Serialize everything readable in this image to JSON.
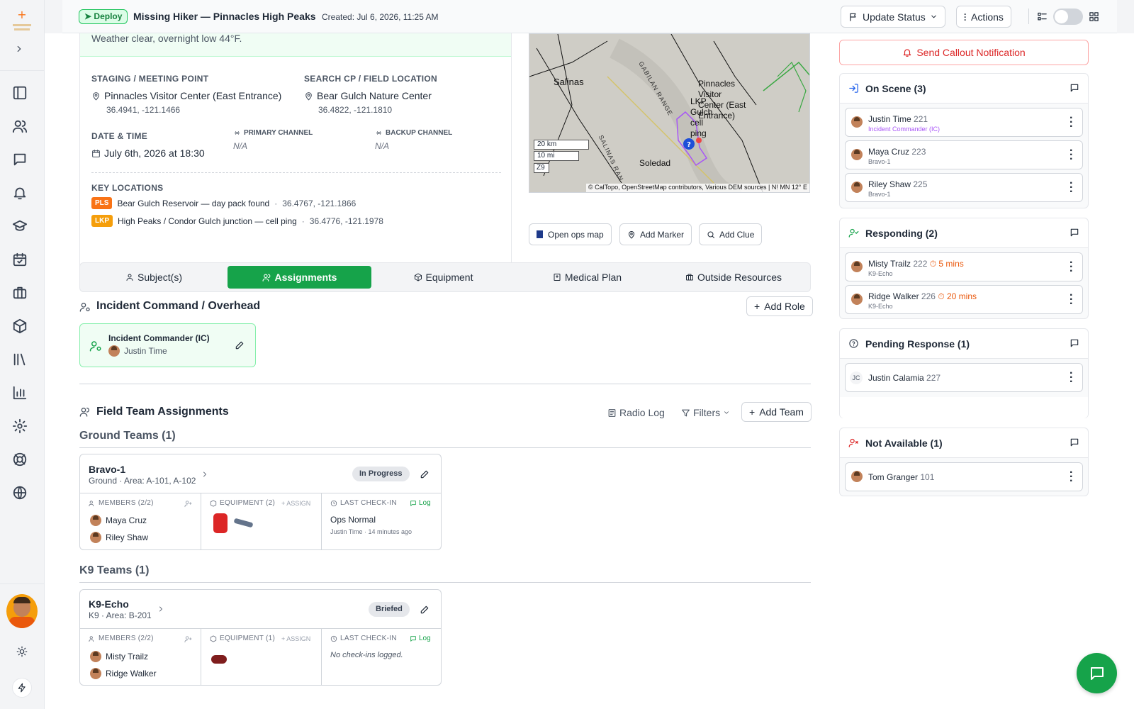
{
  "topbar": {
    "deploy": "Deploy",
    "title": "Missing Hiker — Pinnacles High Peaks",
    "created": "Created: Jul 6, 2026, 11:25 AM",
    "update_status": "Update Status",
    "actions": "Actions"
  },
  "briefing": {
    "weather": "Weather clear, overnight low 44°F.",
    "staging_label": "STAGING / MEETING POINT",
    "staging_name": "Pinnacles Visitor Center (East Entrance)",
    "staging_coords": "36.4941, -121.1466",
    "cp_label": "SEARCH CP / FIELD LOCATION",
    "cp_name": "Bear Gulch Nature Center",
    "cp_coords": "36.4822, -121.1810",
    "datetime_label": "DATE & TIME",
    "datetime": "July 6th, 2026 at 18:30",
    "primary_label": "PRIMARY CHANNEL",
    "primary": "N/A",
    "backup_label": "BACKUP CHANNEL",
    "backup": "N/A",
    "keyloc_label": "KEY LOCATIONS",
    "key_locations": [
      {
        "tag": "PLS",
        "text": "Bear Gulch Reservoir — day pack found",
        "coords": "36.4767, -121.1866"
      },
      {
        "tag": "LKP",
        "text": "High Peaks / Condor Gulch junction — cell ping",
        "coords": "36.4776, -121.1978"
      }
    ]
  },
  "map": {
    "labels": {
      "salinas": "Salinas",
      "pinnacles": "Pinnacles Visitor Center (East Entrance)",
      "lkp": "LKP Gulch cell ping",
      "soledad": "Soledad",
      "gabilan": "GABILAN RANGE",
      "salinasrange": "SALINAS RAN"
    },
    "scale_km": "20 km",
    "scale_mi": "10 mi",
    "zoom": "Z9",
    "attribution": "© CalTopo, OpenStreetMap contributors, Various DEM sources | N! MN 12° E",
    "open_ops": "Open ops map",
    "add_marker": "Add Marker",
    "add_clue": "Add Clue"
  },
  "tabs": [
    "Subject(s)",
    "Assignments",
    "Equipment",
    "Medical Plan",
    "Outside Resources"
  ],
  "command": {
    "title": "Incident Command / Overhead",
    "add_role": "Add Role",
    "role": "Incident Commander (IC)",
    "person": "Justin Time"
  },
  "field": {
    "title": "Field Team Assignments",
    "radio_log": "Radio Log",
    "filters": "Filters",
    "add_team": "Add Team"
  },
  "ground": {
    "title": "Ground Teams (1)",
    "team": {
      "name": "Bravo-1",
      "sub": "Ground · Area: A-101, A-102",
      "status": "In Progress",
      "members_label": "MEMBERS (2/2)",
      "members": [
        "Maya Cruz",
        "Riley Shaw"
      ],
      "equip_label": "EQUIPMENT (2)",
      "assign": "+ ASSIGN",
      "checkin_label": "LAST CHECK-IN",
      "log": "Log",
      "checkin": "Ops Normal",
      "checkin_meta": "Justin Time · 14 minutes ago"
    }
  },
  "k9": {
    "title": "K9 Teams (1)",
    "team": {
      "name": "K9-Echo",
      "sub": "K9 · Area: B-201",
      "status": "Briefed",
      "members_label": "MEMBERS (2/2)",
      "members": [
        "Misty Trailz",
        "Ridge Walker"
      ],
      "equip_label": "EQUIPMENT (1)",
      "assign": "+ ASSIGN",
      "checkin_label": "LAST CHECK-IN",
      "log": "Log",
      "checkin": "No check-ins logged."
    }
  },
  "right": {
    "callout": "Send Callout Notification",
    "on_scene": {
      "title": "On Scene (3)",
      "rows": [
        {
          "name": "Justin Time",
          "num": "221",
          "sub": "Incident Commander (IC)"
        },
        {
          "name": "Maya Cruz",
          "num": "223",
          "sub": "Bravo-1"
        },
        {
          "name": "Riley Shaw",
          "num": "225",
          "sub": "Bravo-1"
        }
      ]
    },
    "responding": {
      "title": "Responding (2)",
      "rows": [
        {
          "name": "Misty Trailz",
          "num": "222",
          "eta": "5 mins",
          "sub": "K9-Echo"
        },
        {
          "name": "Ridge Walker",
          "num": "226",
          "eta": "20 mins",
          "sub": "K9-Echo"
        }
      ]
    },
    "pending": {
      "title": "Pending Response (1)",
      "rows": [
        {
          "initials": "JC",
          "name": "Justin Calamia",
          "num": "227"
        }
      ]
    },
    "na": {
      "title": "Not Available (1)",
      "rows": [
        {
          "name": "Tom Granger",
          "num": "101"
        }
      ]
    }
  },
  "colors": {
    "green": "#16a34a",
    "red": "#dc2626",
    "orange": "#ea580c",
    "purple": "#a855f7",
    "blue": "#1d4ed8"
  }
}
